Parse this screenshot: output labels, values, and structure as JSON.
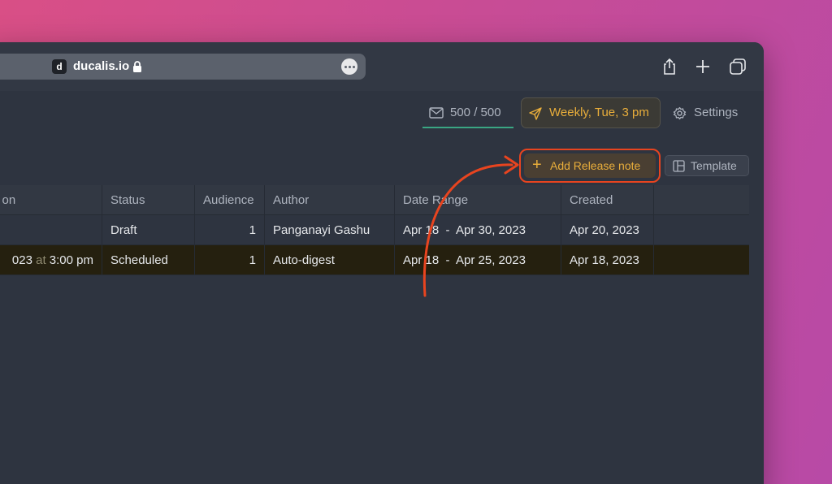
{
  "browser": {
    "favicon_letter": "d",
    "domain": "ducalis.io"
  },
  "toolbar": {
    "email_count": "500 / 500",
    "schedule": "Weekly, Tue, 3 pm",
    "settings": "Settings",
    "add_release_note": "Add Release note",
    "template": "Template"
  },
  "table": {
    "headers": [
      "d on",
      "Status",
      "Audience",
      "Author",
      "Date Range",
      "Created"
    ],
    "rows": [
      {
        "sent_on_prefix": "",
        "sent_on_at": "",
        "sent_on_time": "",
        "status": "Draft",
        "audience": "1",
        "author": "Panganayi Gashu",
        "date_range": "Apr 18  -  Apr 30, 2023",
        "created": "Apr 20, 2023"
      },
      {
        "sent_on_prefix": "023",
        "sent_on_at": "at",
        "sent_on_time": "3:00 pm",
        "status": "Scheduled",
        "audience": "1",
        "author": "Auto-digest",
        "date_range": "Apr 18  -  Apr 25, 2023",
        "created": "Apr 18, 2023"
      }
    ]
  },
  "colors": {
    "accent_orange": "#e9ae3b",
    "highlight_red": "#e8441f",
    "email_underline": "#3aa683"
  }
}
